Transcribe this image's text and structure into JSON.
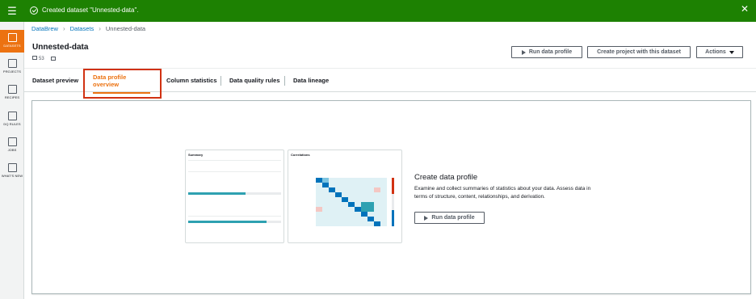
{
  "banner": {
    "message": "Created dataset \"Unnested-data\".",
    "color": "#1d8102"
  },
  "sidebar": {
    "items": [
      {
        "label": "DATASETS",
        "icon": "grid-icon"
      },
      {
        "label": "PROJECTS",
        "icon": "table-icon"
      },
      {
        "label": "RECIPES",
        "icon": "document-icon"
      },
      {
        "label": "DQ RULES",
        "icon": "checklist-icon"
      },
      {
        "label": "JOBS",
        "icon": "play-icon"
      },
      {
        "label": "WHAT'S NEW",
        "icon": "news-icon"
      }
    ]
  },
  "breadcrumb": {
    "root": "DataBrew",
    "section": "Datasets",
    "current": "Unnested-data"
  },
  "page": {
    "title": "Unnested-data",
    "count": "53"
  },
  "actions": {
    "run_profile": "Run data profile",
    "create_project": "Create project with this dataset",
    "actions": "Actions"
  },
  "tabs": [
    "Dataset preview",
    "Data profile overview",
    "Column statistics",
    "Data quality rules",
    "Data lineage"
  ],
  "preview": {
    "summary_title": "Summary",
    "correlations_title": "Correlations"
  },
  "create": {
    "title": "Create data profile",
    "description": "Examine and collect summaries of statistics about your data. Assess data in terms of structure, content, relationships, and derivation.",
    "button": "Run data profile"
  },
  "colors": {
    "accent": "#ec7211",
    "link": "#0073bb",
    "highlight": "#d13212"
  }
}
